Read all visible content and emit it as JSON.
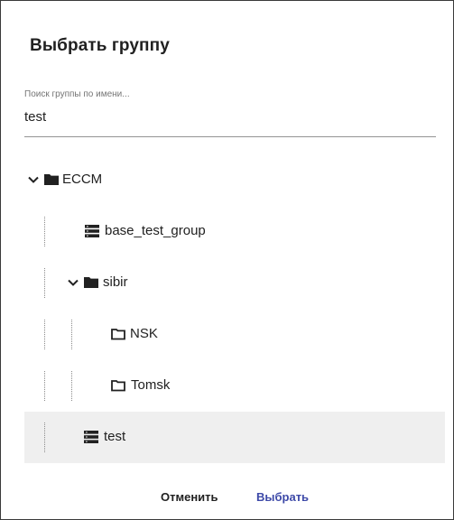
{
  "dialog": {
    "title": "Выбрать группу"
  },
  "search": {
    "label": "Поиск группы по имени...",
    "value": "test"
  },
  "tree": [
    {
      "label": "ECCM",
      "type": "folder",
      "icon": "folder-solid-icon",
      "expanded": true,
      "depth": 0
    },
    {
      "label": "base_test_group",
      "type": "group",
      "icon": "list-icon",
      "depth": 1
    },
    {
      "label": "sibir",
      "type": "folder",
      "icon": "folder-solid-icon",
      "expanded": true,
      "depth": 1
    },
    {
      "label": "NSK",
      "type": "folder",
      "icon": "folder-outline-icon",
      "depth": 2
    },
    {
      "label": "Tomsk",
      "type": "folder",
      "icon": "folder-outline-icon",
      "depth": 2
    },
    {
      "label": "test",
      "type": "group",
      "icon": "list-icon",
      "depth": 1,
      "selected": true
    }
  ],
  "actions": {
    "cancel_label": "Отменить",
    "select_label": "Выбрать"
  },
  "colors": {
    "accent": "#3d49a8",
    "text": "#212121",
    "selected_row": "#efefef"
  }
}
